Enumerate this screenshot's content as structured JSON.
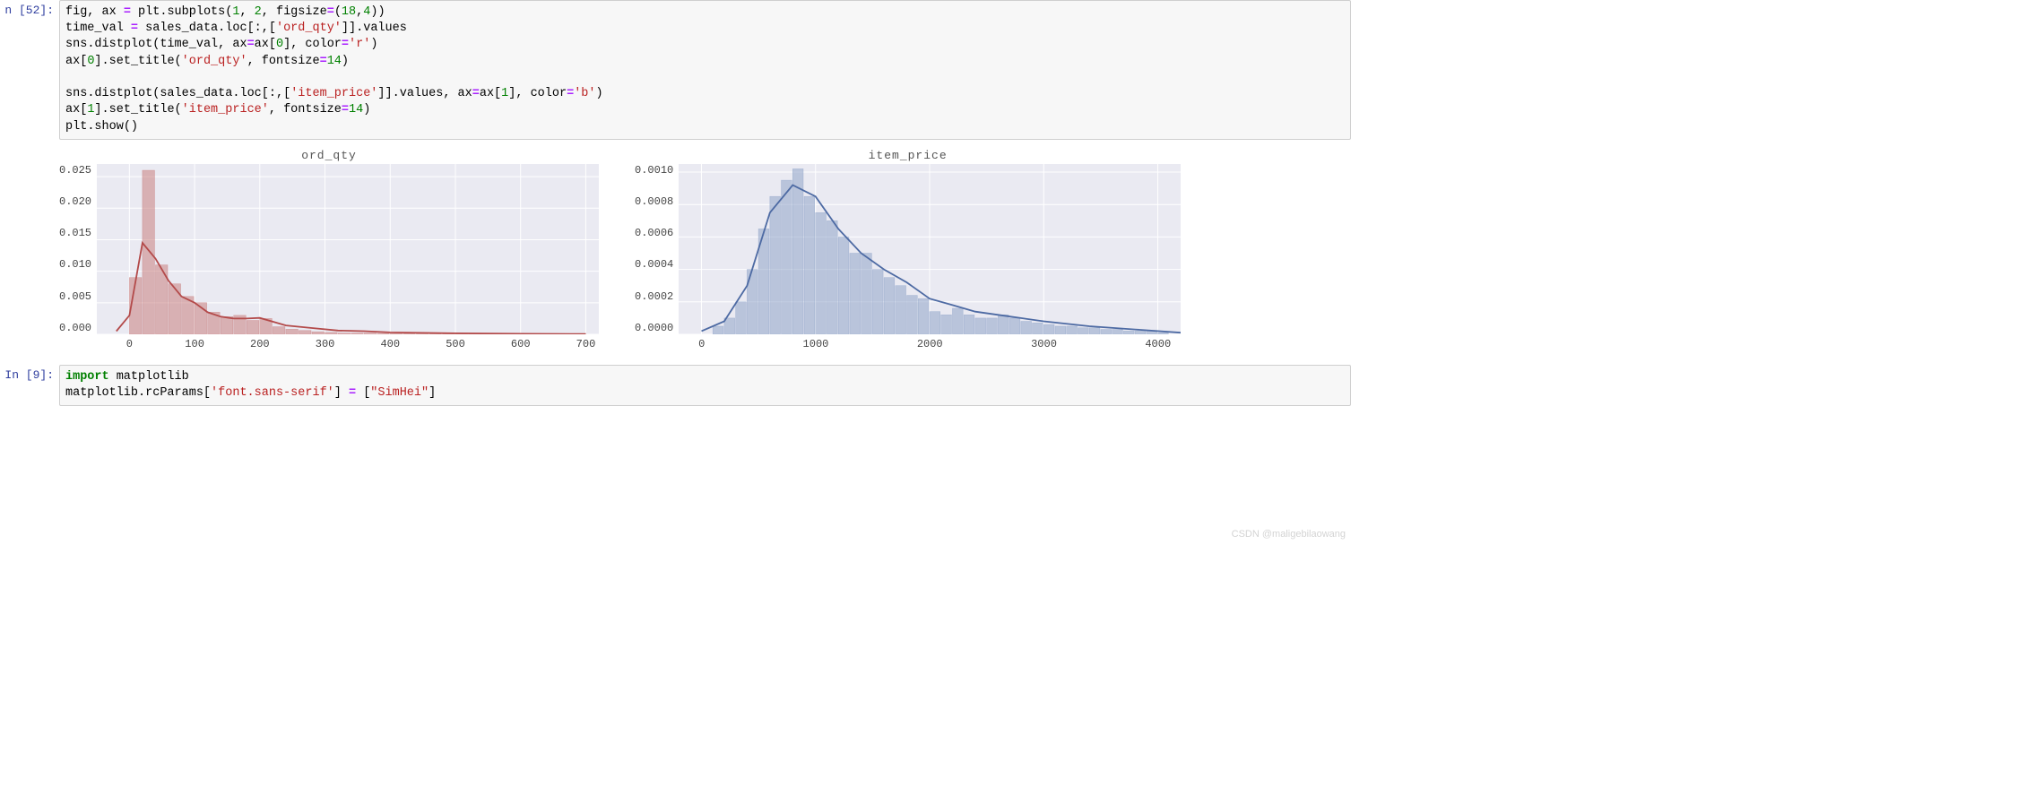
{
  "cells": {
    "cell52": {
      "prompt_label": "n [52]:",
      "code_lines": [
        [
          {
            "t": "fig, ax ",
            "c": "name"
          },
          {
            "t": "=",
            "c": "op"
          },
          {
            "t": " plt",
            "c": "name"
          },
          {
            "t": ".",
            "c": "punct"
          },
          {
            "t": "subplots(",
            "c": "func"
          },
          {
            "t": "1",
            "c": "num"
          },
          {
            "t": ", ",
            "c": "punct"
          },
          {
            "t": "2",
            "c": "num"
          },
          {
            "t": ", figsize",
            "c": "name"
          },
          {
            "t": "=",
            "c": "op"
          },
          {
            "t": "(",
            "c": "punct"
          },
          {
            "t": "18",
            "c": "num"
          },
          {
            "t": ",",
            "c": "punct"
          },
          {
            "t": "4",
            "c": "num"
          },
          {
            "t": "))",
            "c": "punct"
          }
        ],
        [
          {
            "t": "time_val ",
            "c": "name"
          },
          {
            "t": "=",
            "c": "op"
          },
          {
            "t": " sales_data",
            "c": "name"
          },
          {
            "t": ".",
            "c": "punct"
          },
          {
            "t": "loc[:,[",
            "c": "func"
          },
          {
            "t": "'ord_qty'",
            "c": "str"
          },
          {
            "t": "]]",
            "c": "punct"
          },
          {
            "t": ".",
            "c": "punct"
          },
          {
            "t": "values",
            "c": "name"
          }
        ],
        [
          {
            "t": "sns",
            "c": "name"
          },
          {
            "t": ".",
            "c": "punct"
          },
          {
            "t": "distplot(time_val, ax",
            "c": "func"
          },
          {
            "t": "=",
            "c": "op"
          },
          {
            "t": "ax[",
            "c": "name"
          },
          {
            "t": "0",
            "c": "num"
          },
          {
            "t": "], color",
            "c": "name"
          },
          {
            "t": "=",
            "c": "op"
          },
          {
            "t": "'r'",
            "c": "str"
          },
          {
            "t": ")",
            "c": "punct"
          }
        ],
        [
          {
            "t": "ax[",
            "c": "name"
          },
          {
            "t": "0",
            "c": "num"
          },
          {
            "t": "]",
            "c": "name"
          },
          {
            "t": ".",
            "c": "punct"
          },
          {
            "t": "set_title(",
            "c": "func"
          },
          {
            "t": "'ord_qty'",
            "c": "str"
          },
          {
            "t": ", fontsize",
            "c": "name"
          },
          {
            "t": "=",
            "c": "op"
          },
          {
            "t": "14",
            "c": "num"
          },
          {
            "t": ")",
            "c": "punct"
          }
        ],
        [
          {
            "t": "",
            "c": "name"
          }
        ],
        [
          {
            "t": "sns",
            "c": "name"
          },
          {
            "t": ".",
            "c": "punct"
          },
          {
            "t": "distplot(sales_data",
            "c": "func"
          },
          {
            "t": ".",
            "c": "punct"
          },
          {
            "t": "loc[:,[",
            "c": "func"
          },
          {
            "t": "'item_price'",
            "c": "str"
          },
          {
            "t": "]]",
            "c": "punct"
          },
          {
            "t": ".",
            "c": "punct"
          },
          {
            "t": "values, ax",
            "c": "name"
          },
          {
            "t": "=",
            "c": "op"
          },
          {
            "t": "ax[",
            "c": "name"
          },
          {
            "t": "1",
            "c": "num"
          },
          {
            "t": "], color",
            "c": "name"
          },
          {
            "t": "=",
            "c": "op"
          },
          {
            "t": "'b'",
            "c": "str"
          },
          {
            "t": ")",
            "c": "punct"
          }
        ],
        [
          {
            "t": "ax[",
            "c": "name"
          },
          {
            "t": "1",
            "c": "num"
          },
          {
            "t": "]",
            "c": "name"
          },
          {
            "t": ".",
            "c": "punct"
          },
          {
            "t": "set_title(",
            "c": "func"
          },
          {
            "t": "'item_price'",
            "c": "str"
          },
          {
            "t": ", fontsize",
            "c": "name"
          },
          {
            "t": "=",
            "c": "op"
          },
          {
            "t": "14",
            "c": "num"
          },
          {
            "t": ")",
            "c": "punct"
          }
        ],
        [
          {
            "t": "plt",
            "c": "name"
          },
          {
            "t": ".",
            "c": "punct"
          },
          {
            "t": "show()",
            "c": "func"
          }
        ]
      ]
    },
    "cell9": {
      "prompt_label": "In [9]:",
      "code_lines": [
        [
          {
            "t": "import",
            "c": "kw"
          },
          {
            "t": " matplotlib",
            "c": "name"
          }
        ],
        [
          {
            "t": "matplotlib",
            "c": "name"
          },
          {
            "t": ".",
            "c": "punct"
          },
          {
            "t": "rcParams[",
            "c": "func"
          },
          {
            "t": "'font.sans-serif'",
            "c": "str"
          },
          {
            "t": "] ",
            "c": "punct"
          },
          {
            "t": "=",
            "c": "op"
          },
          {
            "t": " [",
            "c": "punct"
          },
          {
            "t": "\"SimHei\"",
            "c": "str"
          },
          {
            "t": "]",
            "c": "punct"
          }
        ]
      ]
    }
  },
  "chart_data": [
    {
      "type": "bar",
      "title": "ord_qty",
      "xlabel": "",
      "ylabel": "",
      "xlim": [
        -50,
        720
      ],
      "ylim": [
        0.0,
        0.027
      ],
      "xticks": [
        0,
        100,
        200,
        300,
        400,
        500,
        600,
        700
      ],
      "yticks": [
        0.0,
        0.005,
        0.01,
        0.015,
        0.02,
        0.025
      ],
      "yticklabels": [
        "0.000",
        "0.005",
        "0.010",
        "0.015",
        "0.020",
        "0.025"
      ],
      "xticklabels": [
        "0",
        "100",
        "200",
        "300",
        "400",
        "500",
        "600",
        "700"
      ],
      "color": "#c97f7f",
      "kde_color": "#b34a4a",
      "bin_width": 20,
      "bars_x": [
        0,
        20,
        40,
        60,
        80,
        100,
        120,
        140,
        160,
        180,
        200,
        220,
        240,
        260,
        280,
        300,
        320,
        340,
        360,
        380,
        400,
        420,
        440,
        460,
        480,
        500,
        520,
        540,
        560,
        580,
        600,
        620,
        640,
        660,
        680
      ],
      "bars_y": [
        0.009,
        0.026,
        0.011,
        0.008,
        0.006,
        0.005,
        0.0035,
        0.0028,
        0.003,
        0.0022,
        0.0025,
        0.0012,
        0.0008,
        0.0006,
        0.0004,
        0.0003,
        0.0002,
        0.0002,
        0.0002,
        0.00015,
        0.00012,
        0.0001,
        0.0001,
        8e-05,
        8e-05,
        6e-05,
        5e-05,
        5e-05,
        4e-05,
        4e-05,
        3e-05,
        3e-05,
        2e-05,
        2e-05,
        2e-05
      ],
      "kde_x": [
        -20,
        0,
        20,
        40,
        60,
        80,
        100,
        120,
        140,
        160,
        180,
        200,
        240,
        280,
        320,
        360,
        400,
        500,
        600,
        700
      ],
      "kde_y": [
        0.0005,
        0.003,
        0.0145,
        0.012,
        0.0085,
        0.006,
        0.005,
        0.0035,
        0.0028,
        0.0025,
        0.0025,
        0.0026,
        0.0014,
        0.001,
        0.0006,
        0.0005,
        0.0003,
        0.00015,
        8e-05,
        4e-05
      ]
    },
    {
      "type": "bar",
      "title": "item_price",
      "xlabel": "",
      "ylabel": "",
      "xlim": [
        -200,
        4200
      ],
      "ylim": [
        0.0,
        0.00105
      ],
      "xticks": [
        0,
        1000,
        2000,
        3000,
        4000
      ],
      "yticks": [
        0.0,
        0.0002,
        0.0004,
        0.0006,
        0.0008,
        0.001
      ],
      "yticklabels": [
        "0.0000",
        "0.0002",
        "0.0004",
        "0.0006",
        "0.0008",
        "0.0010"
      ],
      "xticklabels": [
        "0",
        "1000",
        "2000",
        "3000",
        "4000"
      ],
      "color": "#8fa4c9",
      "kde_color": "#4d6aa3",
      "bin_width": 100,
      "bars_x": [
        100,
        200,
        300,
        400,
        500,
        600,
        700,
        800,
        900,
        1000,
        1100,
        1200,
        1300,
        1400,
        1500,
        1600,
        1700,
        1800,
        1900,
        2000,
        2100,
        2200,
        2300,
        2400,
        2500,
        2600,
        2700,
        2800,
        2900,
        3000,
        3100,
        3200,
        3300,
        3400,
        3500,
        3600,
        3700,
        3800,
        3900,
        4000
      ],
      "bars_y": [
        5e-05,
        0.0001,
        0.0002,
        0.0004,
        0.00065,
        0.00085,
        0.00095,
        0.00102,
        0.00085,
        0.00075,
        0.0007,
        0.0006,
        0.0005,
        0.0005,
        0.0004,
        0.00035,
        0.0003,
        0.00024,
        0.00022,
        0.00014,
        0.00012,
        0.00016,
        0.00012,
        0.0001,
        0.0001,
        0.00012,
        0.0001,
        8e-05,
        7e-05,
        6e-05,
        5e-05,
        5e-05,
        4e-05,
        4e-05,
        3e-05,
        3e-05,
        2e-05,
        2e-05,
        2e-05,
        1e-05
      ],
      "kde_x": [
        0,
        200,
        400,
        600,
        800,
        1000,
        1200,
        1400,
        1600,
        1800,
        2000,
        2200,
        2400,
        2600,
        2800,
        3000,
        3400,
        3800,
        4200
      ],
      "kde_y": [
        2e-05,
        8e-05,
        0.0003,
        0.00075,
        0.00092,
        0.00085,
        0.00065,
        0.0005,
        0.0004,
        0.00032,
        0.00022,
        0.00018,
        0.00014,
        0.00012,
        0.0001,
        8e-05,
        5e-05,
        3e-05,
        1e-05
      ]
    }
  ],
  "watermark": "CSDN @maligebilaowang"
}
